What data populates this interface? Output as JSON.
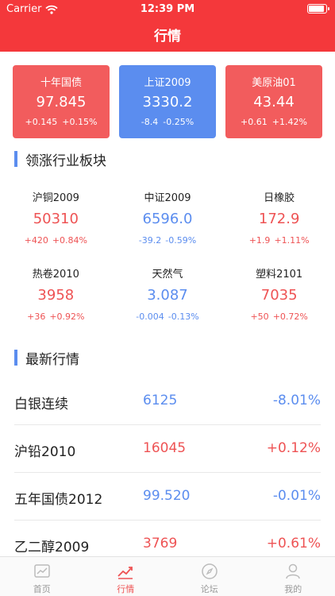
{
  "status_bar": {
    "carrier": "Carrier",
    "time": "12:39 PM"
  },
  "header": {
    "title": "行情"
  },
  "top_cards": [
    {
      "name": "十年国债",
      "price": "97.845",
      "change": "+0.145",
      "percent": "+0.15%",
      "color": "#f25c5d"
    },
    {
      "name": "上证2009",
      "price": "3330.2",
      "change": "-8.4",
      "percent": "-0.25%",
      "color": "#5b8def"
    },
    {
      "name": "美原油01",
      "price": "43.44",
      "change": "+0.61",
      "percent": "+1.42%",
      "color": "#f25c5d"
    }
  ],
  "sectors": {
    "title": "领涨行业板块",
    "items": [
      {
        "name": "沪铜2009",
        "price": "50310",
        "change": "+420",
        "percent": "+0.84%"
      },
      {
        "name": "中证2009",
        "price": "6596.0",
        "change": "-39.2",
        "percent": "-0.59%"
      },
      {
        "name": "日橡胶",
        "price": "172.9",
        "change": "+1.9",
        "percent": "+1.11%"
      },
      {
        "name": "热卷2010",
        "price": "3958",
        "change": "+36",
        "percent": "+0.92%"
      },
      {
        "name": "天然气",
        "price": "3.087",
        "change": "-0.004",
        "percent": "-0.13%"
      },
      {
        "name": "塑料2101",
        "price": "7035",
        "change": "+50",
        "percent": "+0.72%"
      }
    ]
  },
  "latest": {
    "title": "最新行情",
    "rows": [
      {
        "name": "白银连续",
        "price": "6125",
        "percent": "-8.01%"
      },
      {
        "name": "沪铅2010",
        "price": "16045",
        "percent": "+0.12%"
      },
      {
        "name": "五年国债2012",
        "price": "99.520",
        "percent": "-0.01%"
      },
      {
        "name": "乙二醇2009",
        "price": "3769",
        "percent": "+0.61%"
      }
    ]
  },
  "tabbar": {
    "home": "首页",
    "market": "行情",
    "forum": "论坛",
    "mine": "我的"
  },
  "colors": {
    "up": "#ee5354",
    "down": "#5b8def",
    "header": "#f4383b"
  },
  "icons": [
    "wifi-icon",
    "battery-icon",
    "chart-icon",
    "trend-icon",
    "compass-icon",
    "user-icon"
  ]
}
